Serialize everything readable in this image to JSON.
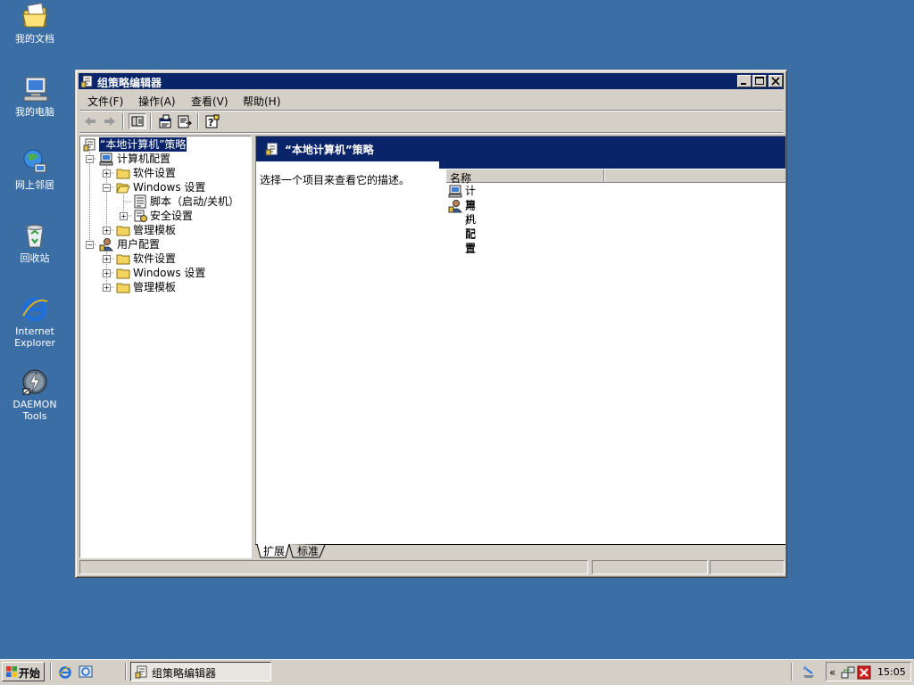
{
  "desktop": {
    "icons": [
      {
        "label": "我的文档",
        "icon": "my-documents-icon"
      },
      {
        "label": "我的电脑",
        "icon": "my-computer-icon"
      },
      {
        "label": "网上邻居",
        "icon": "network-places-icon"
      },
      {
        "label": "回收站",
        "icon": "recycle-bin-icon"
      },
      {
        "label_line1": "Internet",
        "label_line2": "Explorer",
        "icon": "internet-explorer-icon"
      },
      {
        "label": "DAEMON Tools",
        "icon": "daemon-tools-icon"
      }
    ]
  },
  "window": {
    "title": "组策略编辑器",
    "menu": [
      "文件(F)",
      "操作(A)",
      "查看(V)",
      "帮助(H)"
    ],
    "title_buttons": [
      "minimize",
      "maximize",
      "close"
    ]
  },
  "tree": {
    "root": "“本地计算机”策略",
    "computer_config": "计算机配置",
    "computer_children": [
      "软件设置",
      "Windows 设置",
      "管理模板"
    ],
    "windows_settings_children": [
      "脚本（启动/关机）",
      "安全设置"
    ],
    "user_config": "用户配置",
    "user_children": [
      "软件设置",
      "Windows 设置",
      "管理模板"
    ]
  },
  "details": {
    "header": "“本地计算机”策略",
    "description": "选择一个项目来查看它的描述。",
    "column_name": "名称",
    "items": [
      "计算机配置",
      "用户配置"
    ],
    "tabs": [
      "扩展",
      "标准"
    ]
  },
  "taskbar": {
    "start_label": "开始",
    "task_title": "组策略编辑器",
    "clock": "15:05",
    "chevron": "«"
  },
  "colors": {
    "desktop": "#3a6ea5",
    "titlebar": "#0a246a",
    "face": "#d4d0c8"
  }
}
